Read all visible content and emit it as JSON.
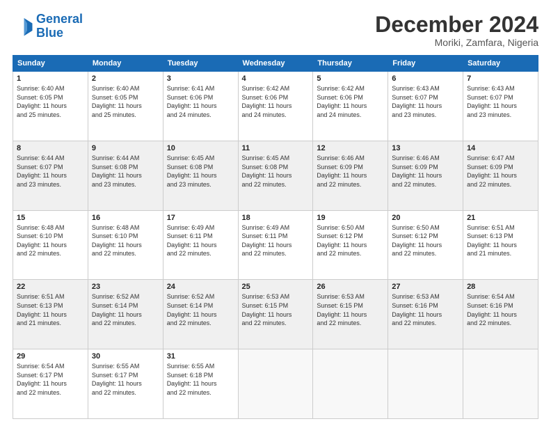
{
  "header": {
    "logo_line1": "General",
    "logo_line2": "Blue",
    "month": "December 2024",
    "location": "Moriki, Zamfara, Nigeria"
  },
  "days_of_week": [
    "Sunday",
    "Monday",
    "Tuesday",
    "Wednesday",
    "Thursday",
    "Friday",
    "Saturday"
  ],
  "weeks": [
    [
      {
        "day": "1",
        "info": "Sunrise: 6:40 AM\nSunset: 6:05 PM\nDaylight: 11 hours\nand 25 minutes."
      },
      {
        "day": "2",
        "info": "Sunrise: 6:40 AM\nSunset: 6:05 PM\nDaylight: 11 hours\nand 25 minutes."
      },
      {
        "day": "3",
        "info": "Sunrise: 6:41 AM\nSunset: 6:06 PM\nDaylight: 11 hours\nand 24 minutes."
      },
      {
        "day": "4",
        "info": "Sunrise: 6:42 AM\nSunset: 6:06 PM\nDaylight: 11 hours\nand 24 minutes."
      },
      {
        "day": "5",
        "info": "Sunrise: 6:42 AM\nSunset: 6:06 PM\nDaylight: 11 hours\nand 24 minutes."
      },
      {
        "day": "6",
        "info": "Sunrise: 6:43 AM\nSunset: 6:07 PM\nDaylight: 11 hours\nand 23 minutes."
      },
      {
        "day": "7",
        "info": "Sunrise: 6:43 AM\nSunset: 6:07 PM\nDaylight: 11 hours\nand 23 minutes."
      }
    ],
    [
      {
        "day": "8",
        "info": "Sunrise: 6:44 AM\nSunset: 6:07 PM\nDaylight: 11 hours\nand 23 minutes."
      },
      {
        "day": "9",
        "info": "Sunrise: 6:44 AM\nSunset: 6:08 PM\nDaylight: 11 hours\nand 23 minutes."
      },
      {
        "day": "10",
        "info": "Sunrise: 6:45 AM\nSunset: 6:08 PM\nDaylight: 11 hours\nand 23 minutes."
      },
      {
        "day": "11",
        "info": "Sunrise: 6:45 AM\nSunset: 6:08 PM\nDaylight: 11 hours\nand 22 minutes."
      },
      {
        "day": "12",
        "info": "Sunrise: 6:46 AM\nSunset: 6:09 PM\nDaylight: 11 hours\nand 22 minutes."
      },
      {
        "day": "13",
        "info": "Sunrise: 6:46 AM\nSunset: 6:09 PM\nDaylight: 11 hours\nand 22 minutes."
      },
      {
        "day": "14",
        "info": "Sunrise: 6:47 AM\nSunset: 6:09 PM\nDaylight: 11 hours\nand 22 minutes."
      }
    ],
    [
      {
        "day": "15",
        "info": "Sunrise: 6:48 AM\nSunset: 6:10 PM\nDaylight: 11 hours\nand 22 minutes."
      },
      {
        "day": "16",
        "info": "Sunrise: 6:48 AM\nSunset: 6:10 PM\nDaylight: 11 hours\nand 22 minutes."
      },
      {
        "day": "17",
        "info": "Sunrise: 6:49 AM\nSunset: 6:11 PM\nDaylight: 11 hours\nand 22 minutes."
      },
      {
        "day": "18",
        "info": "Sunrise: 6:49 AM\nSunset: 6:11 PM\nDaylight: 11 hours\nand 22 minutes."
      },
      {
        "day": "19",
        "info": "Sunrise: 6:50 AM\nSunset: 6:12 PM\nDaylight: 11 hours\nand 22 minutes."
      },
      {
        "day": "20",
        "info": "Sunrise: 6:50 AM\nSunset: 6:12 PM\nDaylight: 11 hours\nand 22 minutes."
      },
      {
        "day": "21",
        "info": "Sunrise: 6:51 AM\nSunset: 6:13 PM\nDaylight: 11 hours\nand 21 minutes."
      }
    ],
    [
      {
        "day": "22",
        "info": "Sunrise: 6:51 AM\nSunset: 6:13 PM\nDaylight: 11 hours\nand 21 minutes."
      },
      {
        "day": "23",
        "info": "Sunrise: 6:52 AM\nSunset: 6:14 PM\nDaylight: 11 hours\nand 22 minutes."
      },
      {
        "day": "24",
        "info": "Sunrise: 6:52 AM\nSunset: 6:14 PM\nDaylight: 11 hours\nand 22 minutes."
      },
      {
        "day": "25",
        "info": "Sunrise: 6:53 AM\nSunset: 6:15 PM\nDaylight: 11 hours\nand 22 minutes."
      },
      {
        "day": "26",
        "info": "Sunrise: 6:53 AM\nSunset: 6:15 PM\nDaylight: 11 hours\nand 22 minutes."
      },
      {
        "day": "27",
        "info": "Sunrise: 6:53 AM\nSunset: 6:16 PM\nDaylight: 11 hours\nand 22 minutes."
      },
      {
        "day": "28",
        "info": "Sunrise: 6:54 AM\nSunset: 6:16 PM\nDaylight: 11 hours\nand 22 minutes."
      }
    ],
    [
      {
        "day": "29",
        "info": "Sunrise: 6:54 AM\nSunset: 6:17 PM\nDaylight: 11 hours\nand 22 minutes."
      },
      {
        "day": "30",
        "info": "Sunrise: 6:55 AM\nSunset: 6:17 PM\nDaylight: 11 hours\nand 22 minutes."
      },
      {
        "day": "31",
        "info": "Sunrise: 6:55 AM\nSunset: 6:18 PM\nDaylight: 11 hours\nand 22 minutes."
      },
      {
        "day": "",
        "info": ""
      },
      {
        "day": "",
        "info": ""
      },
      {
        "day": "",
        "info": ""
      },
      {
        "day": "",
        "info": ""
      }
    ]
  ]
}
